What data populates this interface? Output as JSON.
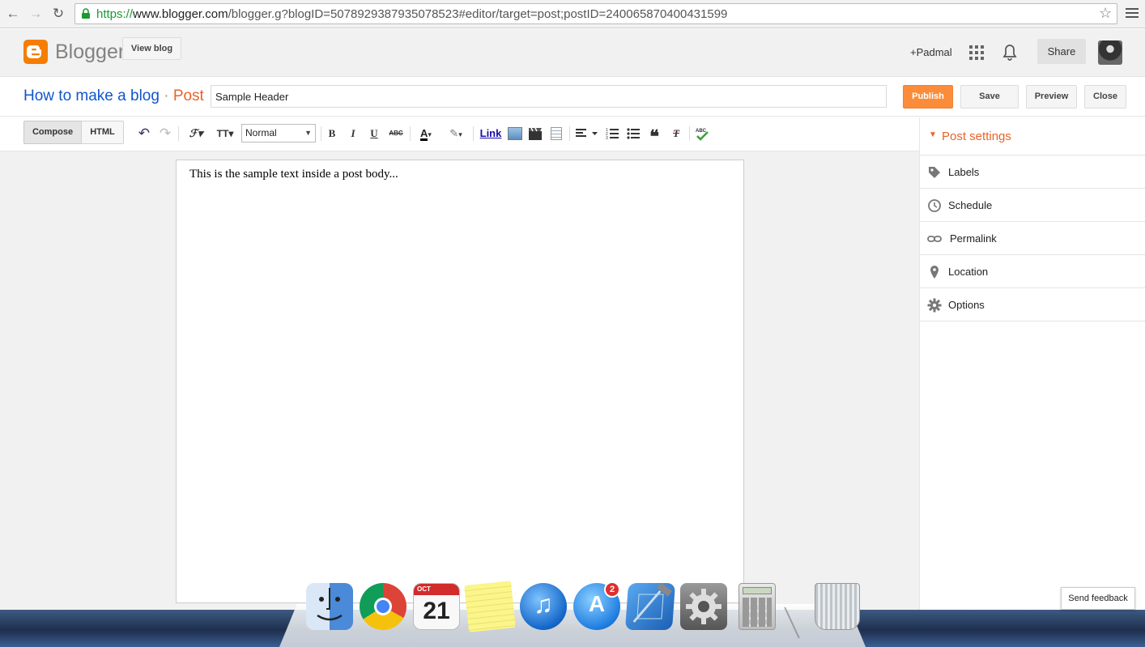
{
  "browser": {
    "url_scheme": "https://",
    "url_domain": "www.blogger.com",
    "url_path": "/blogger.g?blogID=5078929387935078523#editor/target=post;postID=2400658704004315​99"
  },
  "header": {
    "brand": "Blogger",
    "view_blog": "View blog",
    "user": "+Padmal",
    "share": "Share"
  },
  "titlebar": {
    "blog_name": "How to make a blog",
    "separator": "·",
    "section": "Post",
    "post_title": "Sample Header",
    "publish": "Publish",
    "save": "Save",
    "preview": "Preview",
    "close": "Close"
  },
  "toolbar": {
    "compose": "Compose",
    "html": "HTML",
    "format_select": "Normal",
    "link": "Link",
    "bold": "B",
    "italic": "I",
    "underline": "U",
    "strike": "ABC"
  },
  "editor": {
    "body_text": "This is the sample text inside a post body..."
  },
  "sidebar": {
    "header": "Post settings",
    "items": [
      {
        "label": "Labels",
        "icon": "tag-icon"
      },
      {
        "label": "Schedule",
        "icon": "clock-icon"
      },
      {
        "label": "Permalink",
        "icon": "link-icon"
      },
      {
        "label": "Location",
        "icon": "pin-icon"
      },
      {
        "label": "Options",
        "icon": "gear-icon"
      }
    ]
  },
  "feedback": "Send feedback",
  "dock": {
    "calendar_month": "OCT",
    "calendar_day": "21",
    "appstore_badge": "2"
  },
  "colors": {
    "accent": "#f57d00",
    "publish_bg": "#fb8c3a",
    "link_blue": "#1155cc",
    "post_orange": "#e8632a",
    "secure_green": "#1a9a32"
  }
}
